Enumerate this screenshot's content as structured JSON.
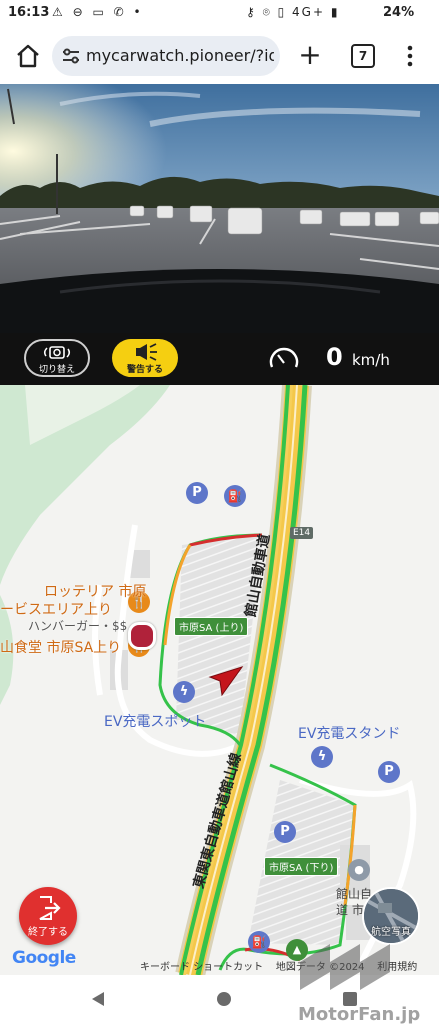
{
  "status_bar": {
    "time": "16:13",
    "left_icons": [
      "warning-icon",
      "sync-icon",
      "sim-icon",
      "wifi-calling-icon",
      "dot-icon"
    ],
    "right_icons": [
      "key-icon",
      "location-icon",
      "vibrate-icon",
      "signal-icon"
    ],
    "network": "4G+",
    "battery": "24%"
  },
  "browser": {
    "url": "mycarwatch.pioneer/?id=",
    "tab_count": "7"
  },
  "controls": {
    "switch_label": "切り替え",
    "warn_label": "警告する",
    "speed_value": "0",
    "speed_unit": "km/h",
    "warn_color": "#f5cf11"
  },
  "map": {
    "route_badge": "E14",
    "expressway_vertical": "館山自動車道",
    "expressway_diagonal": "東関東自動車道館山線",
    "poi": {
      "lotteria_line1": "ロッテリア 市原",
      "lotteria_line2": "ービスエリア上り",
      "lotteria_line3": "ハンバーガー・$$",
      "shokudo": "山食堂 市原SA上り",
      "sa_up": "市原SA (上り)",
      "sa_down": "市原SA (下り)",
      "ev_spot": "EV充電スポット",
      "ev_stand": "EV充電スタンド",
      "tateyama_line1": "館山自",
      "tateyama_line2": "道 市原"
    },
    "end_label": "終了する",
    "aerial_label": "航空写真",
    "google": "Google",
    "footer_shortcuts": "キーボード ショートカット",
    "footer_data": "地図データ ©2024",
    "footer_terms": "利用規約"
  },
  "watermark": {
    "text": "MotorFan.jp"
  }
}
